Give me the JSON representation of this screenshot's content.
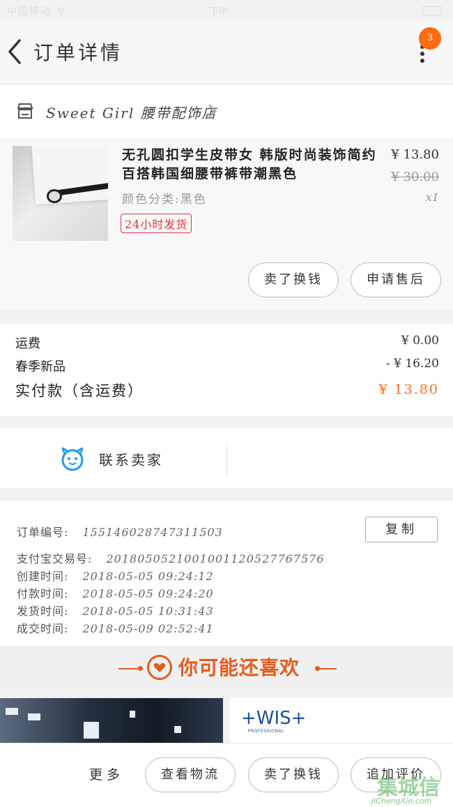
{
  "status_bar": {
    "carrier": "中国移动 令 ···",
    "time": "下午"
  },
  "navbar": {
    "title": "订单详情",
    "badge_count": "3"
  },
  "shop": {
    "name": "Sweet Girl 腰带配饰店"
  },
  "product": {
    "name": "无孔圆扣学生皮带女 韩版时尚装饰简约百搭韩国细腰带裤带潮黑色",
    "sku": "颜色分类:黑色",
    "tag": "24小时发货",
    "price": "¥ 13.80",
    "original_price": "¥ 30.00",
    "quantity": "x1",
    "actions": [
      "卖了换钱",
      "申请售后"
    ]
  },
  "fees": {
    "shipping_label": "运费",
    "shipping_value": "¥ 0.00",
    "promo_label": "春季新品",
    "promo_value": "- ¥ 16.20",
    "total_label": "实付款（含运费）",
    "total_value": "¥ 13.80",
    "accent": "#ff6a13"
  },
  "contact": {
    "label": "联系卖家"
  },
  "order_info": {
    "copy_label": "复制",
    "rows": [
      {
        "label": "订单编号:",
        "value": "155146028747311503"
      },
      {
        "label": "支付宝交易号:",
        "value": "2018050521001001120527767576"
      },
      {
        "label": "创建时间:",
        "value": "2018-05-05 09:24:12"
      },
      {
        "label": "付款时间:",
        "value": "2018-05-05 09:24:20"
      },
      {
        "label": "发货时间:",
        "value": "2018-05-05 10:31:43"
      },
      {
        "label": "成交时间:",
        "value": "2018-05-09 02:52:41"
      }
    ]
  },
  "recommend": {
    "title": "你可能还喜欢",
    "brand_logo": "+WIS+",
    "brand_sub": "PROFESSIONAL"
  },
  "bottom_bar": {
    "more": "更多",
    "buttons": [
      "查看物流",
      "卖了换钱",
      "追加评价"
    ]
  },
  "watermark": {
    "text": "集城信",
    "url": "JiChengXin.com"
  }
}
